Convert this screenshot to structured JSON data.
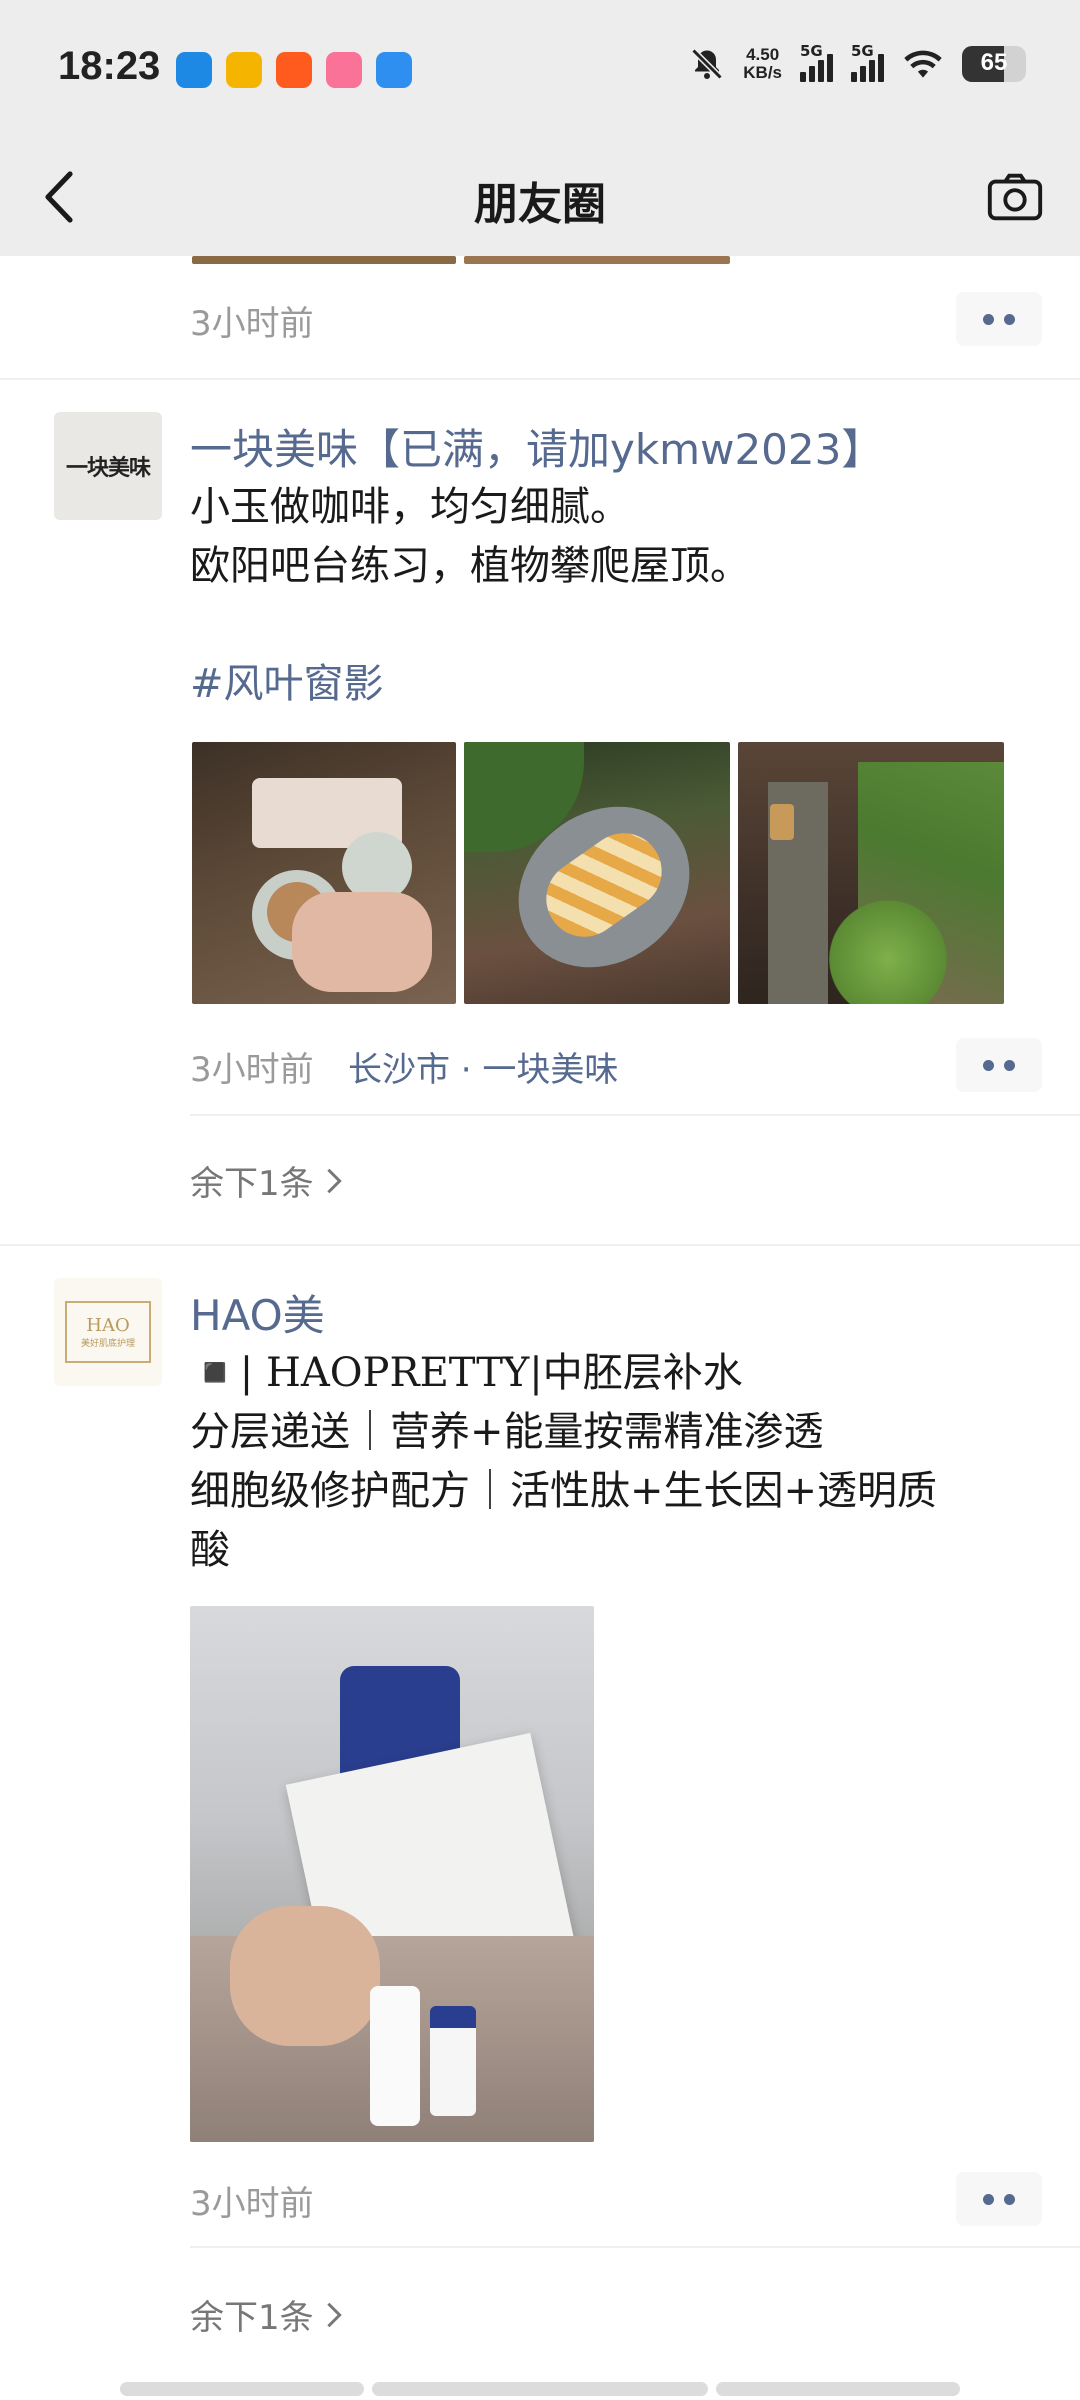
{
  "status_bar": {
    "time": "18:23",
    "net_speed_value": "4.50",
    "net_speed_unit": "KB/s",
    "signal1_label": "5G",
    "signal2_label": "5G",
    "battery": "65",
    "battery_level": 0.65
  },
  "nav": {
    "title": "朋友圈"
  },
  "prev_post": {
    "time": "3小时前"
  },
  "post1": {
    "author": "一块美味【已满，请加ykmw2023】",
    "avatar_text": "一块美味",
    "lines": [
      "小玉做咖啡，均匀细腻。",
      "欧阳吧台练习，植物攀爬屋顶。"
    ],
    "hashtag": "#风叶窗影",
    "time": "3小时前",
    "location": "长沙市 · 一块美味",
    "more": "余下1条"
  },
  "post2": {
    "author": "HAO美",
    "avatar_text": "HAO",
    "avatar_sub": "美好肌底护理",
    "lines": [
      "◾️| HAOPRETTY|中胚层补水",
      "分层递送｜营养+能量按需精准渗透",
      "细胞级修护配方｜活性肽+生长因+透明质",
      "酸"
    ],
    "time": "3小时前",
    "more": "余下1条"
  },
  "colors": {
    "link": "#56698f",
    "bar_bg": "#ededed"
  }
}
